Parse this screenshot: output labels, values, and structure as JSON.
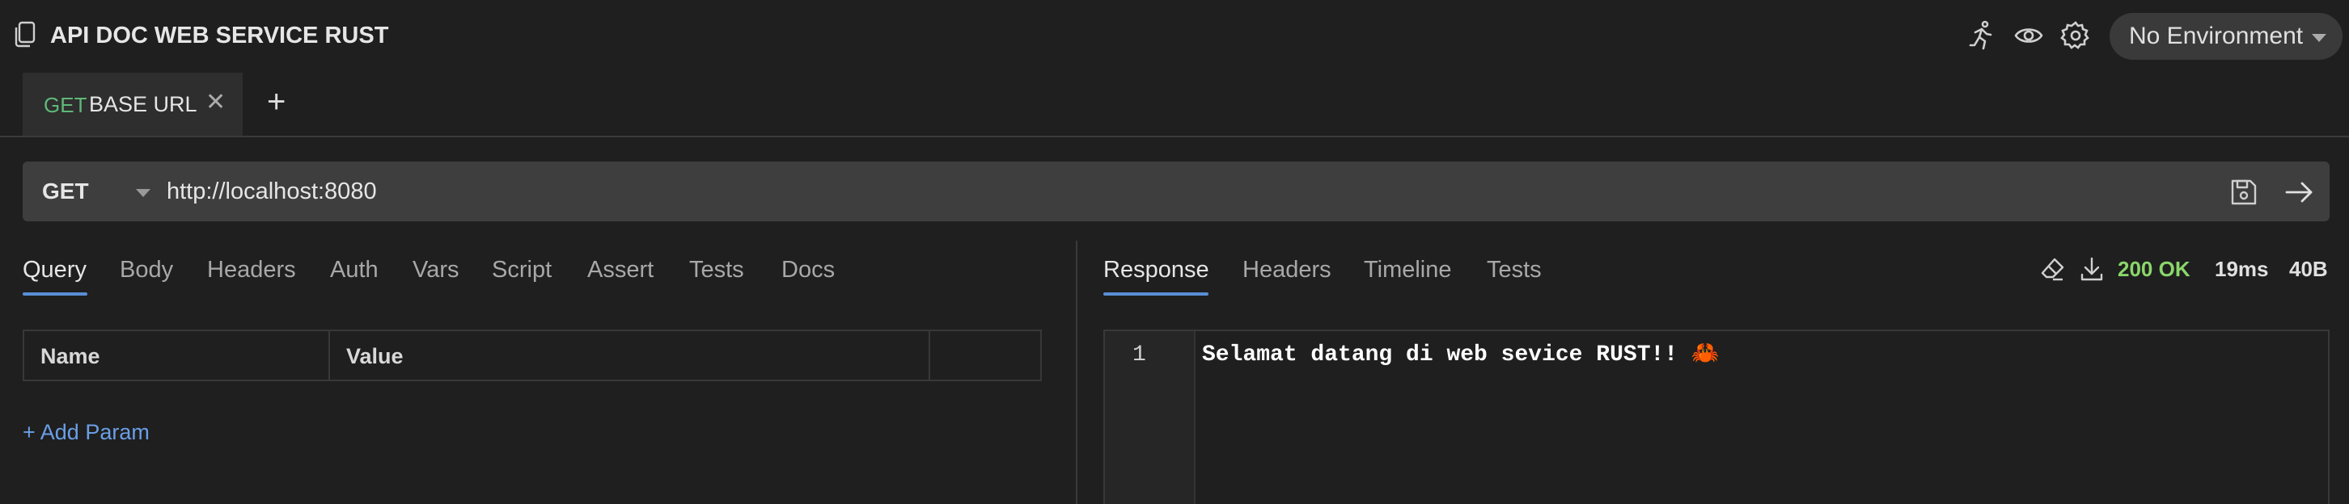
{
  "app": {
    "title": "API DOC WEB SERVICE RUST",
    "environment": "No Environment"
  },
  "header_icons": [
    "runner-icon",
    "eye-icon",
    "gear-icon"
  ],
  "request_tab": {
    "method": "GET",
    "name": "BASE URL",
    "close": "✕",
    "new_tab": "+"
  },
  "url_bar": {
    "method": "GET",
    "url": "http://localhost:8080"
  },
  "request_tabs": [
    "Query",
    "Body",
    "Headers",
    "Auth",
    "Vars",
    "Script",
    "Assert",
    "Tests",
    "Docs"
  ],
  "params_table": {
    "columns": [
      "Name",
      "Value"
    ],
    "add_label": "+ Add Param"
  },
  "response_tabs": [
    "Response",
    "Headers",
    "Timeline",
    "Tests"
  ],
  "response_status": {
    "status": "200 OK",
    "time": "19ms",
    "size": "40B"
  },
  "response_body": {
    "line_number": "1",
    "text": "Selamat datang di web sevice RUST!! ",
    "emoji": "🦀"
  },
  "colors": {
    "background": "#1f1f1f",
    "accent": "#5a8fd6",
    "method_get": "#5fb878",
    "status_ok": "#8ad66b",
    "link": "#6a9fe6"
  }
}
